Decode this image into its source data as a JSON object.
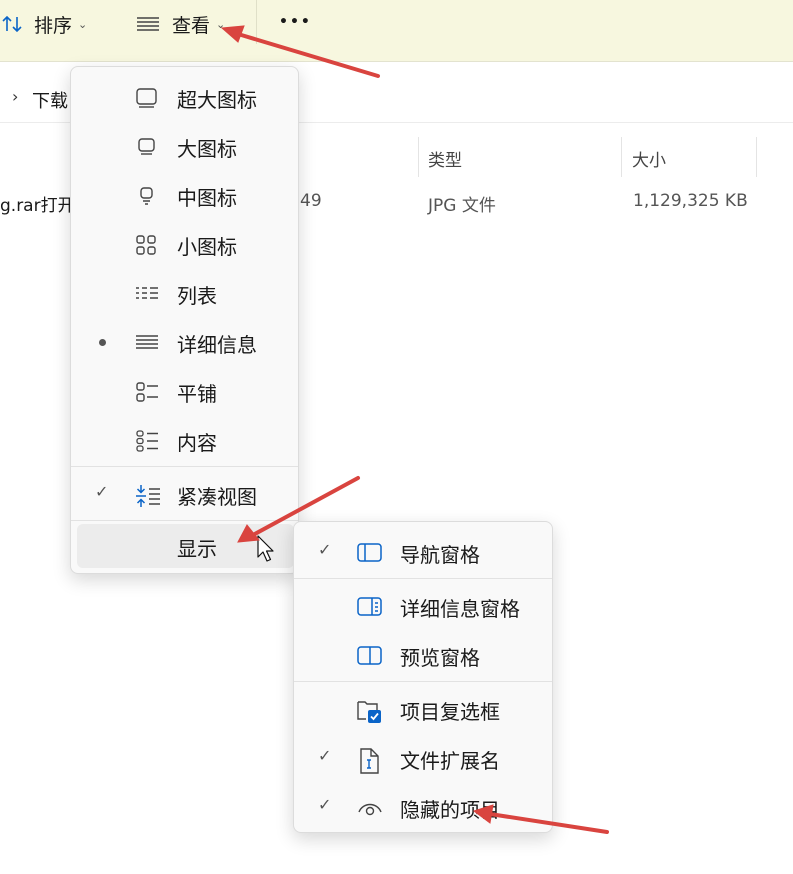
{
  "toolbar": {
    "sort_label": "排序",
    "view_label": "查看",
    "more_label": "•••"
  },
  "address": {
    "folder": "下载"
  },
  "columns": {
    "type": "类型",
    "size": "大小"
  },
  "file_row": {
    "name_fragment": "g.rar打开",
    "date_fragment": "49",
    "type": "JPG 文件",
    "size": "1,129,325 KB"
  },
  "view_menu": {
    "items": [
      {
        "label": "超大图标",
        "icon": "extra-large-icons-icon"
      },
      {
        "label": "大图标",
        "icon": "large-icons-icon"
      },
      {
        "label": "中图标",
        "icon": "medium-icons-icon"
      },
      {
        "label": "小图标",
        "icon": "small-icons-icon"
      },
      {
        "label": "列表",
        "icon": "list-icon"
      },
      {
        "label": "详细信息",
        "icon": "details-icon",
        "selected": true
      },
      {
        "label": "平铺",
        "icon": "tiles-icon"
      },
      {
        "label": "内容",
        "icon": "content-icon"
      },
      {
        "label": "紧凑视图",
        "icon": "compact-view-icon",
        "checked": true
      },
      {
        "label": "显示",
        "icon": "",
        "hovered": true
      }
    ]
  },
  "show_menu": {
    "items": [
      {
        "label": "导航窗格",
        "icon": "navigation-pane-icon",
        "checked": true
      },
      {
        "label": "详细信息窗格",
        "icon": "details-pane-icon",
        "checked": false
      },
      {
        "label": "预览窗格",
        "icon": "preview-pane-icon",
        "checked": false
      },
      {
        "label": "项目复选框",
        "icon": "item-checkboxes-icon",
        "checked": false
      },
      {
        "label": "文件扩展名",
        "icon": "file-extensions-icon",
        "checked": true
      },
      {
        "label": "隐藏的项目",
        "icon": "hidden-items-icon",
        "checked": true
      }
    ]
  },
  "colors": {
    "toolbar_bg": "#f7f7df",
    "accent": "#0a64c8",
    "annotation_arrow": "#d9443f"
  }
}
